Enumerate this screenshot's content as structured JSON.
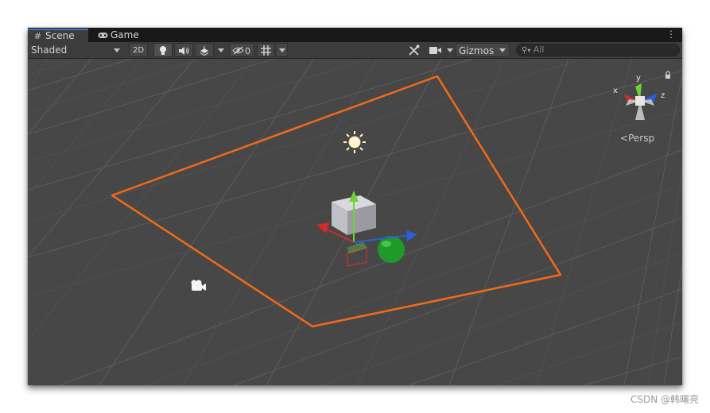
{
  "tabs": [
    {
      "label": "Scene",
      "icon": "hash-icon",
      "active": true
    },
    {
      "label": "Game",
      "icon": "gamepad-icon",
      "active": false
    }
  ],
  "toolbar": {
    "shading_mode": "Shaded",
    "mode_2d_label": "2D",
    "hidden_count": "0",
    "gizmos_label": "Gizmos",
    "search_placeholder": "All"
  },
  "view_gizmo": {
    "x_label": "x",
    "y_label": "y",
    "z_label": "z",
    "projection_label": "Persp",
    "colors": {
      "x": "#d12b2b",
      "y": "#6fd13a",
      "z": "#2a5fd6"
    }
  },
  "scene": {
    "background_color": "#474747",
    "grid_color": "#5b5b5b",
    "selection_outline_color": "#f26a18",
    "sphere_color": "#1f9a28"
  },
  "watermark": "CSDN @韩曙亮"
}
